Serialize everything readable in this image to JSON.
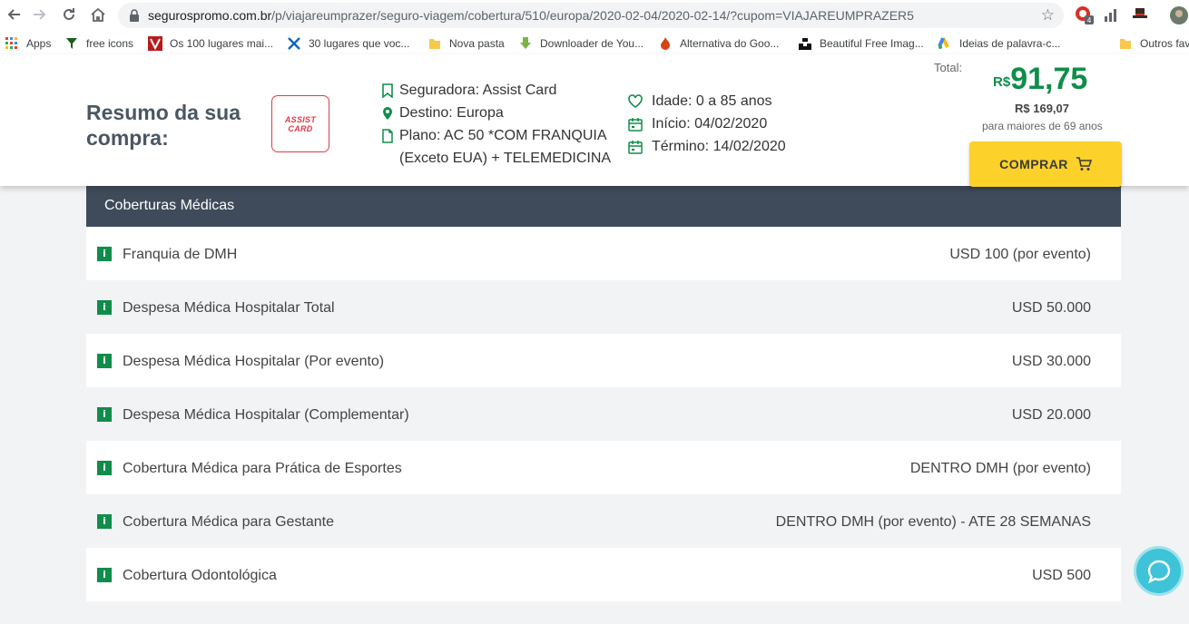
{
  "browser": {
    "url_domain": "segurospromo.com.br",
    "url_path": "/p/viajareumprazer/seguro-viagem/cobertura/510/europa/2020-02-04/2020-02-14/?cupom=VIAJAREUMPRAZER5",
    "extension_badge": "4"
  },
  "bookmarks": [
    {
      "label": "Apps",
      "icon": "apps-grid-icon"
    },
    {
      "label": "free icons",
      "icon": "free-icons-icon"
    },
    {
      "label": "Os 100 lugares mai...",
      "icon": "v-logo-icon"
    },
    {
      "label": "30 lugares que voc...",
      "icon": "plane-icon"
    },
    {
      "label": "Nova pasta",
      "icon": "folder-icon"
    },
    {
      "label": "Downloader de You...",
      "icon": "download-arrow-icon"
    },
    {
      "label": "Alternativa do Goo...",
      "icon": "flame-icon"
    },
    {
      "label": "Beautiful Free Imag...",
      "icon": "unsplash-icon"
    },
    {
      "label": "Ideias de palavra-c...",
      "icon": "google-ads-icon"
    },
    {
      "label": "Outros fav",
      "icon": "folder-icon"
    }
  ],
  "summary": {
    "title": "Resumo da sua compra:",
    "logo_text": "ASSIST CARD",
    "insurer": "Seguradora: Assist Card",
    "destination": "Destino: Europa",
    "plan_line1": "Plano: AC 50 *COM FRANQUIA",
    "plan_line2": "(Exceto EUA) + TELEMEDICINA",
    "age": "Idade: 0 a 85 anos",
    "start": "Início: 04/02/2020",
    "end": "Término: 14/02/2020",
    "total_label": "Total:",
    "currency": "R$",
    "price": "91,75",
    "old_price": "R$ 169,07",
    "price_note": "para maiores de 69 anos",
    "buy_label": "COMPRAR"
  },
  "coverage": {
    "header": "Coberturas Médicas",
    "rows": [
      {
        "label": "Franquia de DMH",
        "value": "USD 100 (por evento)"
      },
      {
        "label": "Despesa Médica Hospitalar Total",
        "value": "USD 50.000"
      },
      {
        "label": "Despesa Médica Hospitalar (Por evento)",
        "value": "USD 30.000"
      },
      {
        "label": "Despesa Médica Hospitalar (Complementar)",
        "value": "USD 20.000"
      },
      {
        "label": "Cobertura Médica para Prática de Esportes",
        "value": "DENTRO DMH (por evento)"
      },
      {
        "label": "Cobertura Médica para Gestante",
        "value": "DENTRO DMH (por evento) - ATE 28 SEMANAS"
      },
      {
        "label": "Cobertura Odontológica",
        "value": "USD 500"
      }
    ],
    "info_badge": "i"
  },
  "colors": {
    "accent_green": "#108d4a",
    "header_dark": "#3f4b5a",
    "buy_yellow": "#fcd12a",
    "brand_red": "#e03a44",
    "chat_cyan": "#3ec3d8"
  }
}
